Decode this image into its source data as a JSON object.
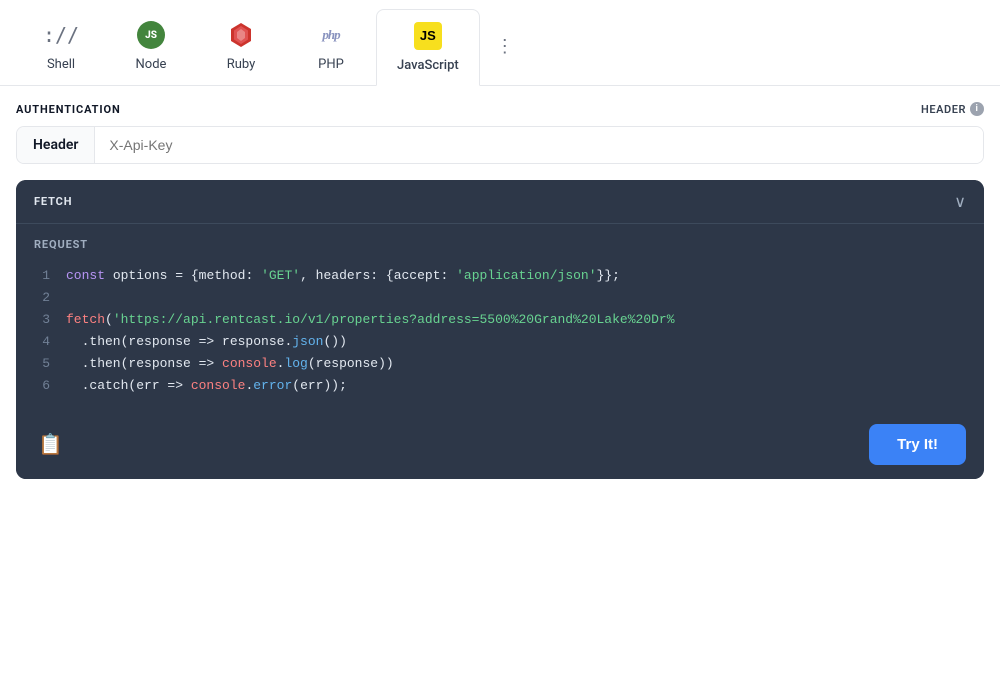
{
  "tabs": [
    {
      "id": "shell",
      "label": "Shell",
      "icon": "shell-icon",
      "active": false
    },
    {
      "id": "node",
      "label": "Node",
      "icon": "node-icon",
      "active": false
    },
    {
      "id": "ruby",
      "label": "Ruby",
      "icon": "ruby-icon",
      "active": false
    },
    {
      "id": "php",
      "label": "PHP",
      "icon": "php-icon",
      "active": false
    },
    {
      "id": "javascript",
      "label": "JavaScript",
      "icon": "js-icon",
      "active": true
    }
  ],
  "more_button_label": "⋮",
  "auth": {
    "title": "AUTHENTICATION",
    "header_label": "HEADER",
    "input_label": "Header",
    "input_placeholder": "X-Api-Key"
  },
  "code": {
    "section_title": "FETCH",
    "request_label": "REQUEST",
    "lines": [
      {
        "num": "1",
        "content": "const options = {method: 'GET', headers: {accept: 'application/json'}};"
      },
      {
        "num": "2",
        "content": ""
      },
      {
        "num": "3",
        "content": "fetch('https://api.rentcast.io/v1/properties?address=5500%20Grand%20Lake%20Dr%"
      },
      {
        "num": "4",
        "content": "  .then(response => response.json())"
      },
      {
        "num": "5",
        "content": "  .then(response => console.log(response))"
      },
      {
        "num": "6",
        "content": "  .catch(err => console.error(err));"
      }
    ]
  },
  "footer": {
    "copy_icon": "📋",
    "try_it_label": "Try It!"
  }
}
